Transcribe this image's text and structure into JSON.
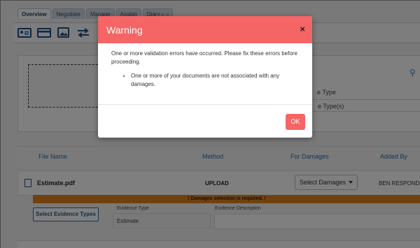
{
  "tabs": [
    {
      "label": "Overview"
    },
    {
      "label": "Negotiate"
    },
    {
      "label": "Manage"
    },
    {
      "label": "Assign"
    },
    {
      "label": "Diary",
      "badge": "16"
    }
  ],
  "background": {
    "type_label": "e Type",
    "types_label": "e Type(s)",
    "columns": {
      "file_name": "File Name",
      "method": "Method",
      "for_damages": "For Damages",
      "added_by": "Added By"
    },
    "file_row": {
      "name": "Estimate.pdf",
      "method": "UPLOAD",
      "select_damages": "Select Damages",
      "added_by": "BEN RESPONDE"
    },
    "error_message": "Damages selection is required.",
    "evidence": {
      "button": "Select Evidence Types",
      "type_header": "Evidence Type",
      "description_header": "Evidence Description",
      "type_value": "Estimate"
    }
  },
  "modal": {
    "title": "Warning",
    "close": "×",
    "message": "One or more validation errors have occurred. Please fix these errors before proceeding.",
    "errors": [
      "One or more of your documents are not associated with any damages."
    ],
    "ok_label": "OK"
  },
  "colors": {
    "modal_header": "#f56565",
    "error_bar": "#e0831f",
    "link_blue": "#2a6ea6"
  }
}
